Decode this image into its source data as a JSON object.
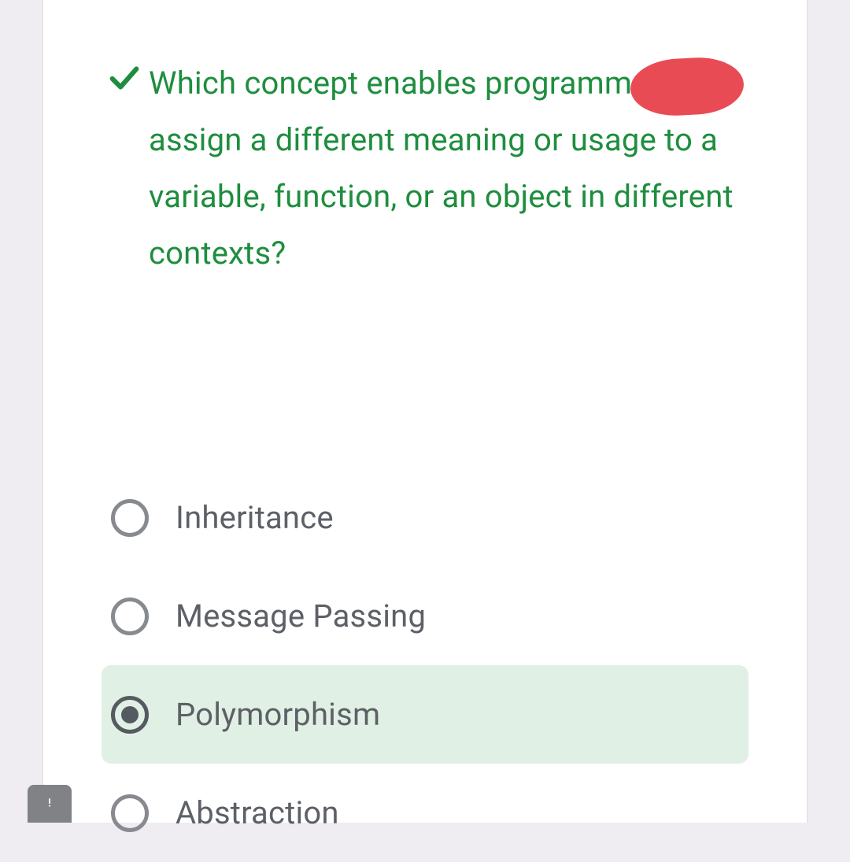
{
  "question": {
    "status": "correct",
    "text": "Which concept enables programmers to assign a different meaning or usage to a variable, function, or an object in different contexts?"
  },
  "options": [
    {
      "label": "Inheritance",
      "selected": false
    },
    {
      "label": "Message Passing",
      "selected": false
    },
    {
      "label": "Polymorphism",
      "selected": true
    },
    {
      "label": "Abstraction",
      "selected": false
    }
  ]
}
